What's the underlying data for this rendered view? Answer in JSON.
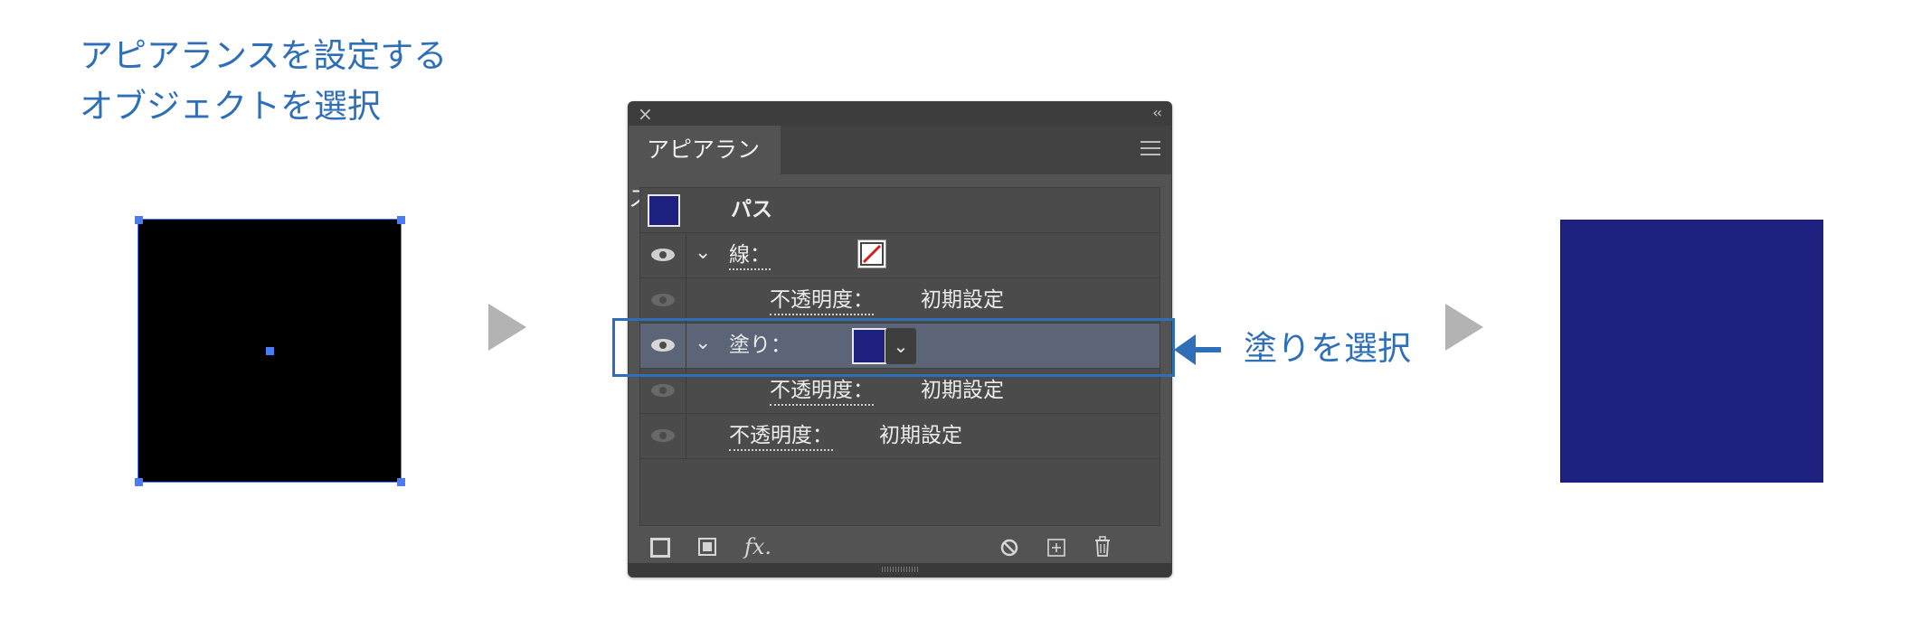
{
  "instruction": {
    "line1": "アピアランスを設定する",
    "line2": "オブジェクトを選択"
  },
  "panel": {
    "close_label": "×",
    "collapse_label": "‹‹",
    "tab_label": "アピアランス",
    "rows": {
      "header_label": "パス",
      "stroke_label": "線：",
      "stroke_opacity_label": "不透明度：",
      "stroke_opacity_value": "初期設定",
      "fill_label": "塗り：",
      "fill_opacity_label": "不透明度：",
      "fill_opacity_value": "初期設定",
      "object_opacity_label": "不透明度：",
      "object_opacity_value": "初期設定"
    },
    "footer": {
      "fx_label": "fx."
    }
  },
  "callout": {
    "text": "塗りを選択"
  },
  "colors": {
    "fill_color": "#1e2080",
    "object_color": "#000000",
    "accent": "#2f6fb8"
  }
}
